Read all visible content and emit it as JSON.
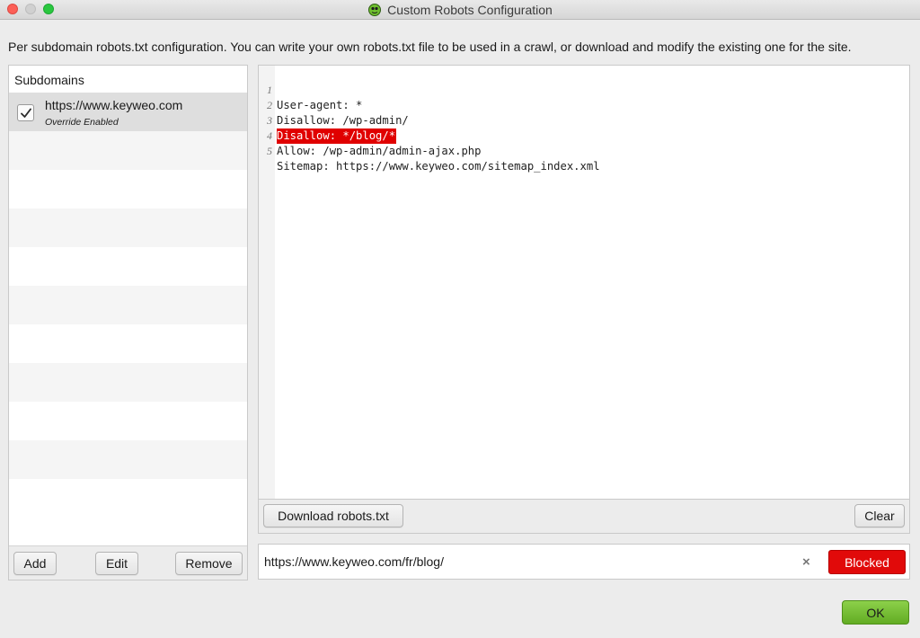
{
  "window": {
    "title": "Custom Robots Configuration",
    "app_icon": "spider-frog-icon"
  },
  "description": "Per subdomain robots.txt configuration. You can write your own robots.txt file to be used in a crawl, or download and modify the existing one for the site.",
  "subdomains": {
    "header": "Subdomains",
    "items": [
      {
        "url": "https://www.keyweo.com",
        "status": "Override Enabled",
        "checked": true
      }
    ],
    "buttons": {
      "add": "Add",
      "edit": "Edit",
      "remove": "Remove"
    }
  },
  "editor": {
    "lines": [
      {
        "num": "1",
        "text": "User-agent: *",
        "highlighted": false
      },
      {
        "num": "2",
        "text": "Disallow: /wp-admin/",
        "highlighted": false
      },
      {
        "num": "3",
        "text": "Disallow: */blog/*",
        "highlighted": true
      },
      {
        "num": "4",
        "text": "Allow: /wp-admin/admin-ajax.php",
        "highlighted": false
      },
      {
        "num": "5",
        "text": "Sitemap: https://www.keyweo.com/sitemap_index.xml",
        "highlighted": false
      }
    ],
    "download_button": "Download robots.txt",
    "clear_button": "Clear"
  },
  "test": {
    "url": "https://www.keyweo.com/fr/blog/",
    "clear_icon": "×",
    "result": "Blocked",
    "result_color": "#e10a0a"
  },
  "ok_button": "OK"
}
